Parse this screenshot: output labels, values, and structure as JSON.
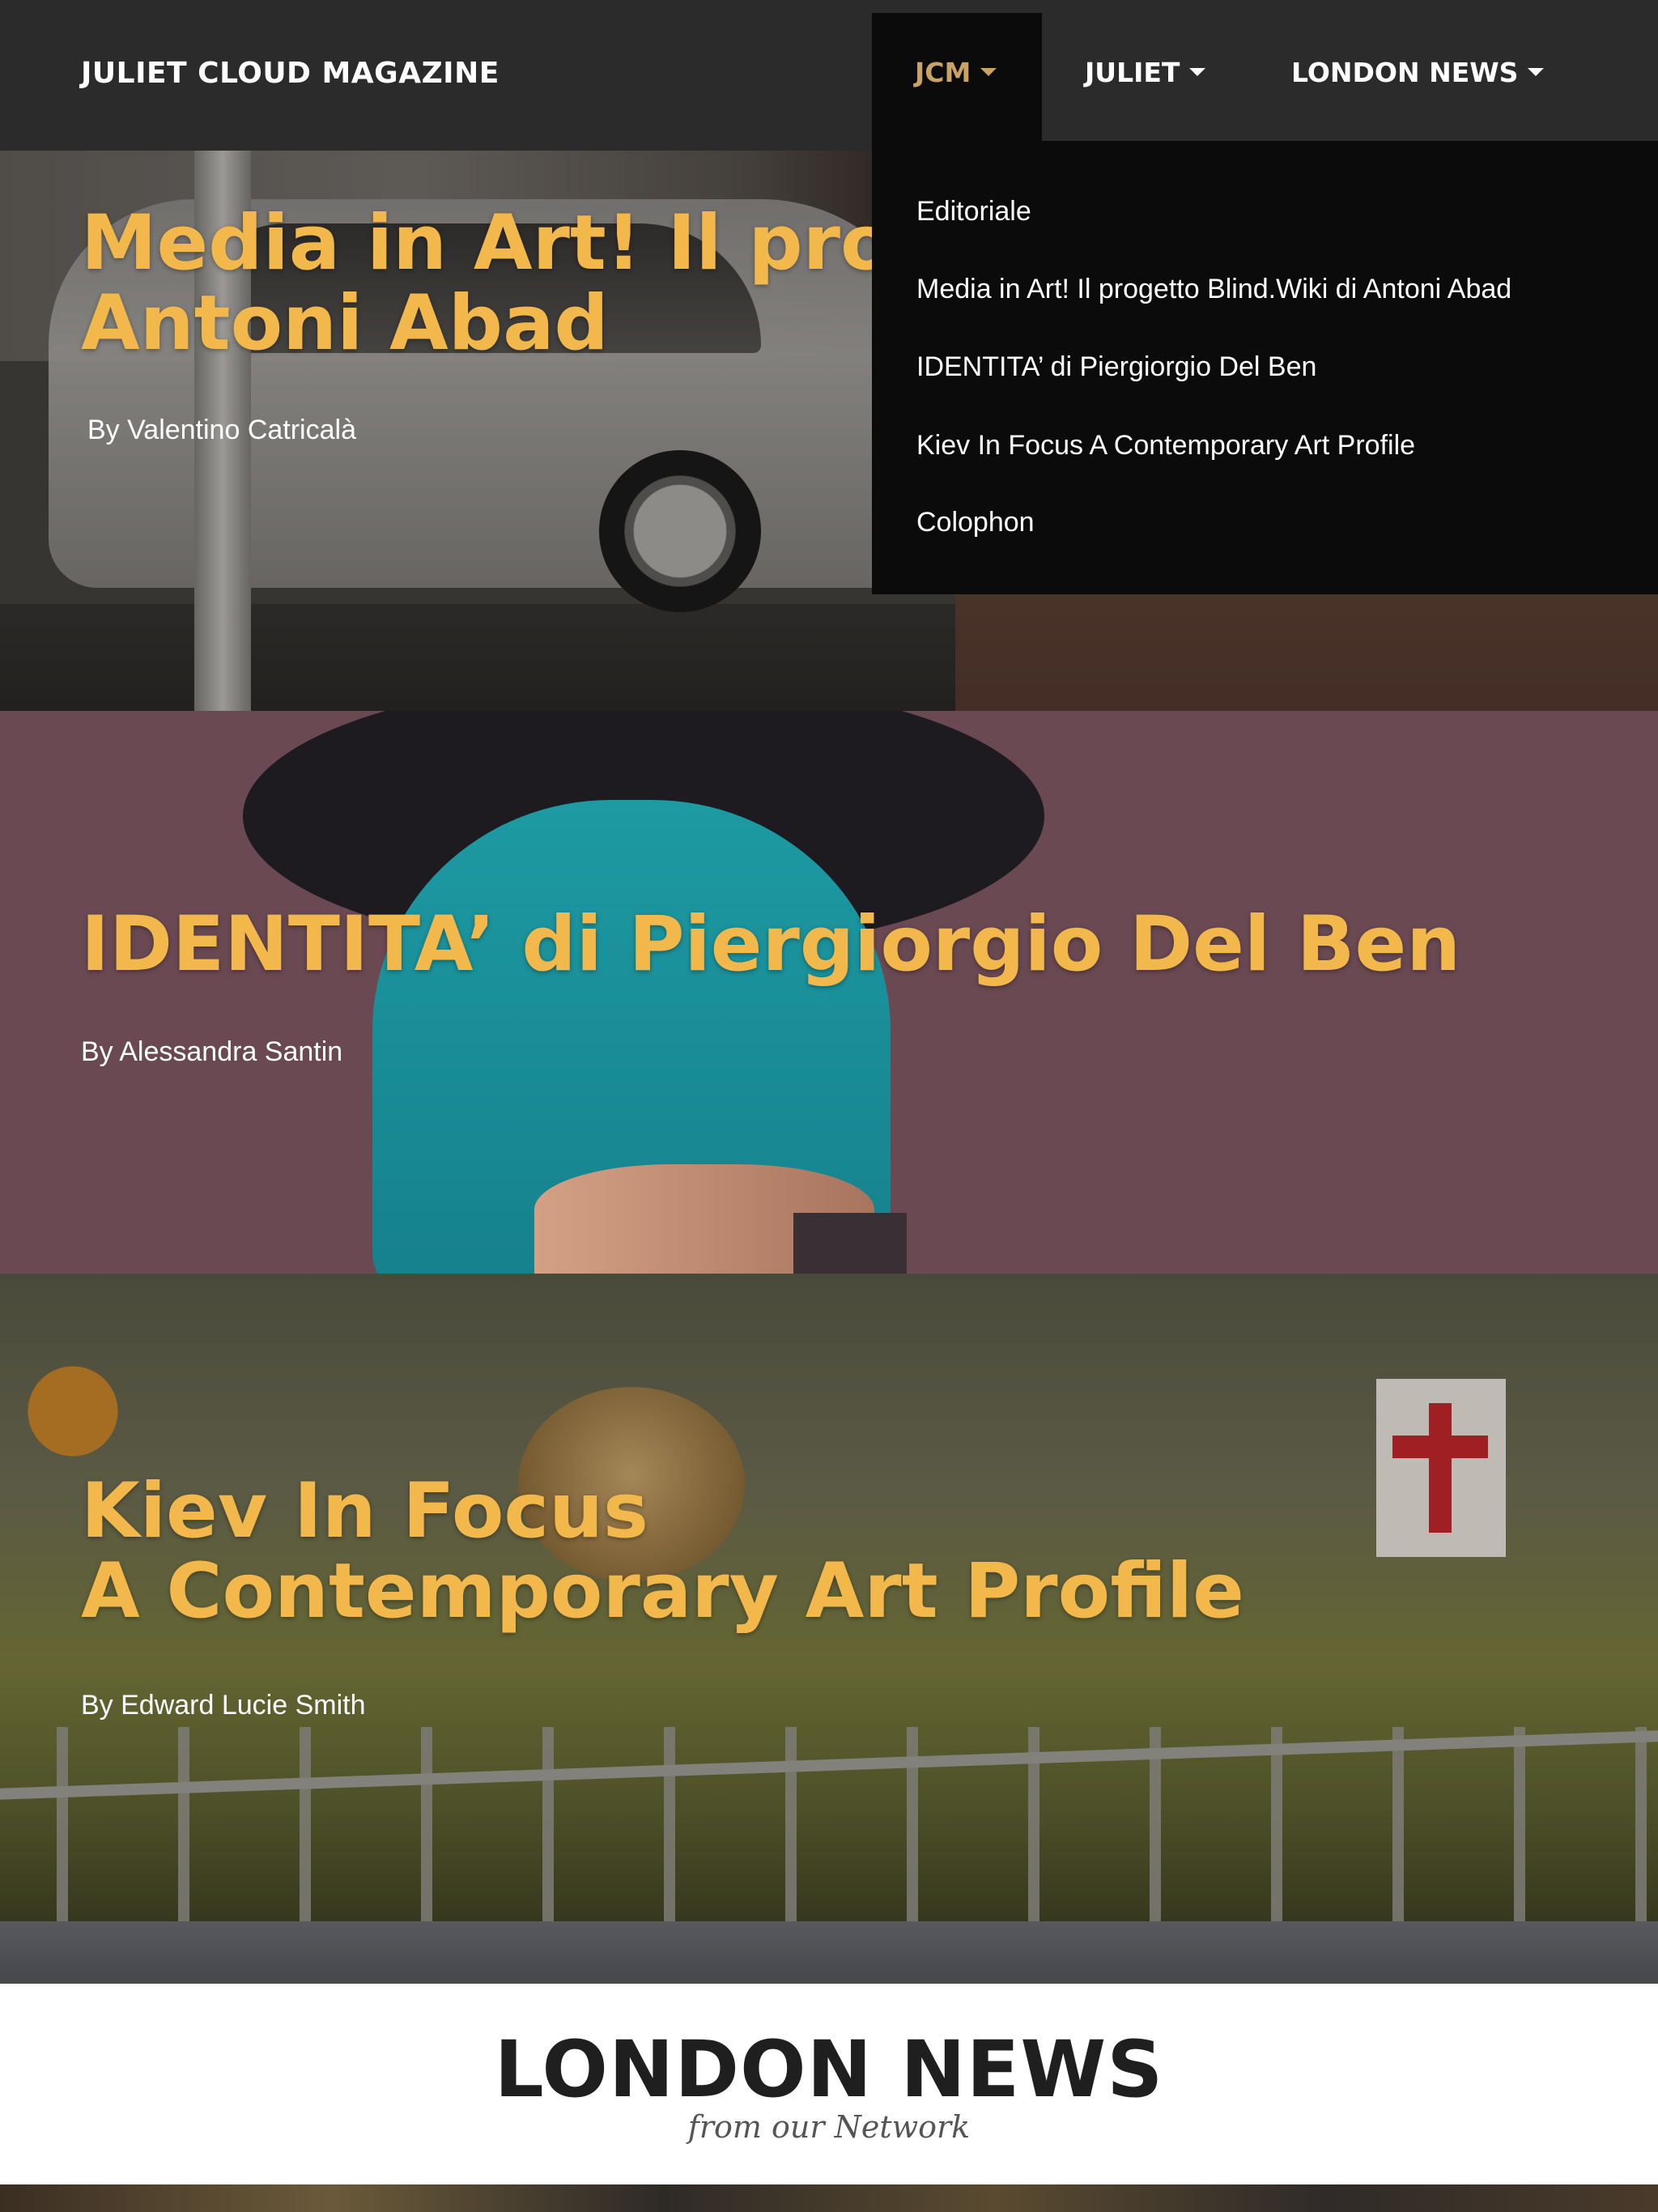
{
  "navbar": {
    "brand": "JULIET CLOUD MAGAZINE",
    "items": [
      {
        "label": "JCM"
      },
      {
        "label": "JULIET"
      },
      {
        "label": "LONDON NEWS"
      }
    ],
    "active_color": "#c9a265"
  },
  "dropdown": {
    "items": [
      {
        "label": "Editoriale"
      },
      {
        "label": "Media in Art! Il progetto Blind.Wiki di Antoni Abad"
      },
      {
        "label": "IDENTITA’ di Piergiorgio Del Ben"
      },
      {
        "label": "Kiev In Focus A Contemporary Art Profile"
      },
      {
        "label": "Colophon"
      }
    ]
  },
  "articles": [
    {
      "title_line1": "Media in Art! Il progetto Blind.Wiki di",
      "title_line2": "Antoni Abad",
      "byline": "By Valentino Catricalà"
    },
    {
      "title_line1": "IDENTITA’ di Piergiorgio Del Ben",
      "byline": "By Alessandra Santin"
    },
    {
      "title_line1": "Kiev In Focus",
      "title_line2": "A Contemporary Art Profile",
      "byline": "By Edward Lucie Smith"
    }
  ],
  "london_news": {
    "title": "LONDON NEWS",
    "subtitle": "from our Network"
  },
  "colors": {
    "title_gold": "#f2b84b",
    "navbar_bg": "#2b2b2b",
    "dropdown_bg": "#0b0b0b",
    "identita_bg": "#6a4952"
  }
}
